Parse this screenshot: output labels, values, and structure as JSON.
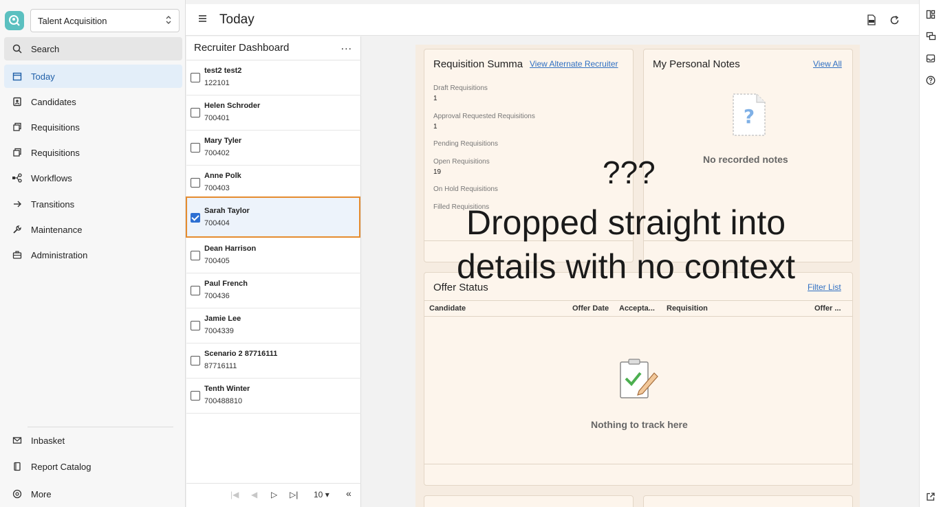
{
  "app": {
    "selector_label": "Talent Acquisition"
  },
  "sidebar": {
    "search_label": "Search",
    "items": [
      {
        "label": "Today",
        "icon": "calendar-icon"
      },
      {
        "label": "Candidates",
        "icon": "candidates-icon"
      },
      {
        "label": "Requisitions",
        "icon": "requisitions-icon"
      },
      {
        "label": "Requisitions",
        "icon": "requisitions-icon"
      },
      {
        "label": "Workflows",
        "icon": "workflow-icon"
      },
      {
        "label": "Transitions",
        "icon": "arrow-right-icon"
      },
      {
        "label": "Maintenance",
        "icon": "wrench-icon"
      },
      {
        "label": "Administration",
        "icon": "briefcase-icon"
      }
    ],
    "bottom_items": [
      {
        "label": "Inbasket",
        "icon": "mail-icon"
      },
      {
        "label": "Report Catalog",
        "icon": "book-icon"
      },
      {
        "label": "More",
        "icon": "more-circle-icon"
      }
    ]
  },
  "header": {
    "title": "Today"
  },
  "list_panel": {
    "title": "Recruiter Dashboard",
    "more_glyph": "...",
    "rows": [
      {
        "name": "test2 test2",
        "id": "122101",
        "checked": false
      },
      {
        "name": "Helen Schroder",
        "id": "700401",
        "checked": false
      },
      {
        "name": "Mary Tyler",
        "id": "700402",
        "checked": false
      },
      {
        "name": "Anne Polk",
        "id": "700403",
        "checked": false
      },
      {
        "name": "Sarah Taylor",
        "id": "700404",
        "checked": true
      },
      {
        "name": "Dean Harrison",
        "id": "700405",
        "checked": false
      },
      {
        "name": "Paul French",
        "id": "700436",
        "checked": false
      },
      {
        "name": "Jamie Lee",
        "id": "7004339",
        "checked": false
      },
      {
        "name": "Scenario 2 87716111",
        "id": "87716111",
        "checked": false
      },
      {
        "name": "Tenth Winter",
        "id": "700488810",
        "checked": false
      }
    ],
    "page_size": "10"
  },
  "requisition_summary": {
    "title": "Requisition Summa",
    "link": "View Alternate Recruiter",
    "items": [
      {
        "label": "Draft Requisitions",
        "value": "1"
      },
      {
        "label": "Approval Requested Requisitions",
        "value": "1"
      },
      {
        "label": "Pending Requisitions",
        "value": ""
      },
      {
        "label": "Open Requisitions",
        "value": "19"
      },
      {
        "label": "On Hold Requisitions",
        "value": ""
      },
      {
        "label": "Filled Requisitions",
        "value": ""
      }
    ]
  },
  "personal_notes": {
    "title": "My Personal Notes",
    "link": "View All",
    "empty_text": "No recorded notes"
  },
  "offer_status": {
    "title": "Offer Status",
    "link": "Filter List",
    "columns": [
      "Candidate",
      "Offer Date",
      "Accepta...",
      "Requisition",
      "Offer ..."
    ],
    "empty_text": "Nothing to track here"
  },
  "annotation": {
    "question": "???",
    "message": "Dropped straight into details with no context"
  },
  "colors": {
    "accent": "#2d6fd2",
    "selection_border": "#e58b2e",
    "link": "#2f6fc2",
    "logo": "#5bc0c0"
  }
}
